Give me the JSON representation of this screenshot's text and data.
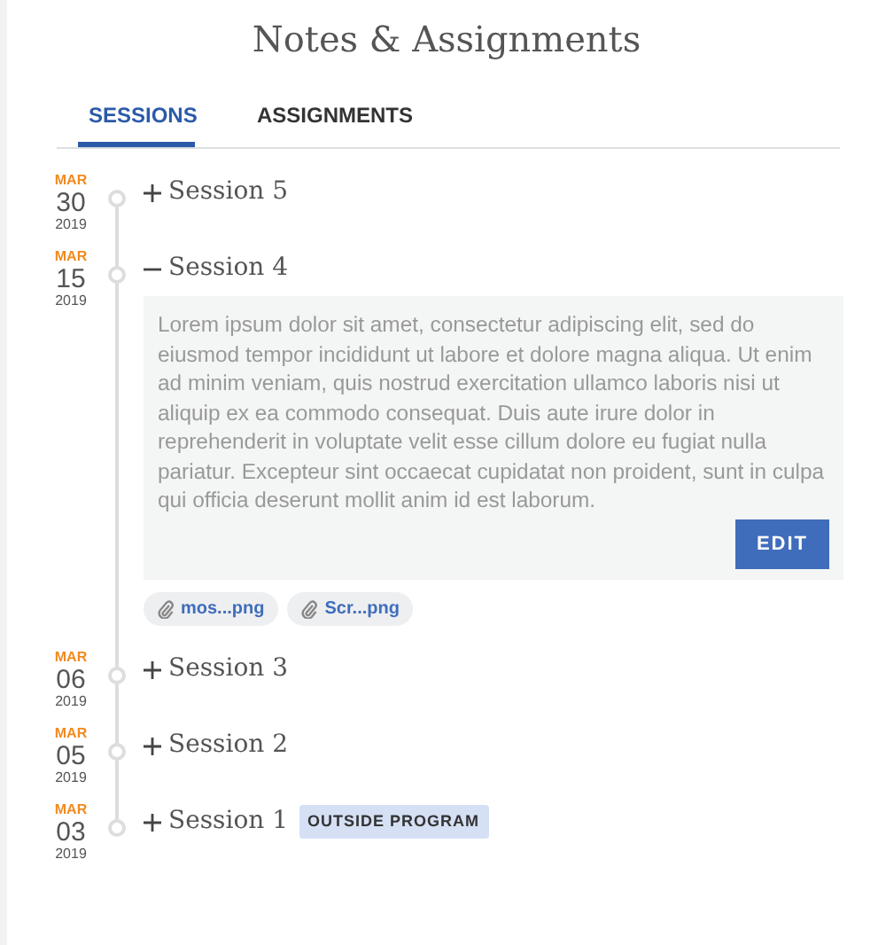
{
  "title": "Notes & Assignments",
  "tabs": [
    {
      "label": "SESSIONS",
      "selected": true
    },
    {
      "label": "ASSIGNMENTS",
      "selected": false
    }
  ],
  "sessions": [
    {
      "month": "MAR",
      "day": "30",
      "year": "2019",
      "title": "Session 5",
      "expanded": false
    },
    {
      "month": "MAR",
      "day": "15",
      "year": "2019",
      "title": "Session 4",
      "expanded": true,
      "note": "Lorem ipsum dolor sit amet, consectetur adipiscing elit, sed do eiusmod tempor incididunt ut labore et dolore magna aliqua. Ut enim ad minim veniam, quis nostrud exercitation ullamco laboris nisi ut aliquip ex ea commodo consequat. Duis aute irure dolor in reprehenderit in voluptate velit esse cillum dolore eu fugiat nulla pariatur. Excepteur sint occaecat cupidatat non proident, sunt in culpa qui officia deserunt mollit anim id est laborum.",
      "edit_button": "EDIT",
      "attachments": [
        "mos...png",
        "Scr...png"
      ]
    },
    {
      "month": "MAR",
      "day": "06",
      "year": "2019",
      "title": "Session 3",
      "expanded": false
    },
    {
      "month": "MAR",
      "day": "05",
      "year": "2019",
      "title": "Session 2",
      "expanded": false
    },
    {
      "month": "MAR",
      "day": "03",
      "year": "2019",
      "title": "Session 1",
      "expanded": false,
      "tag": "OUTSIDE PROGRAM"
    }
  ]
}
